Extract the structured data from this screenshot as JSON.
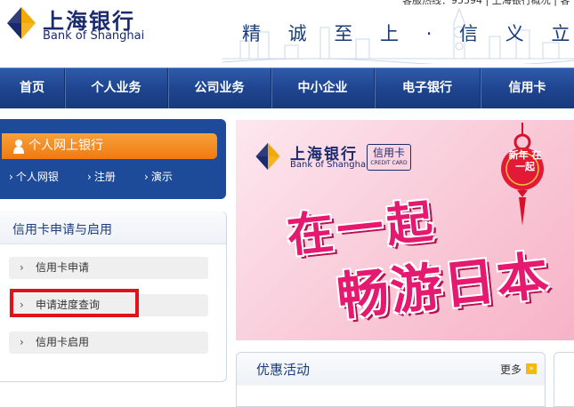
{
  "header": {
    "brand_cn": "上海银行",
    "brand_en": "Bank of Shanghai",
    "hotline": "客服热线：95594 | 上海银行概况 | 客",
    "slogan": "精 诚 至 上 · 信 义 立 行"
  },
  "nav": {
    "items": [
      {
        "label": "首页"
      },
      {
        "label": "个人业务"
      },
      {
        "label": "公司业务"
      },
      {
        "label": "中小企业"
      },
      {
        "label": "电子银行"
      },
      {
        "label": "信用卡"
      }
    ]
  },
  "login": {
    "button_label": "个人网上银行",
    "links": [
      "个人网银",
      "注册",
      "演示"
    ]
  },
  "credit": {
    "title": "信用卡申请与启用",
    "items": [
      {
        "label": "信用卡申请"
      },
      {
        "label": "申请进度查询"
      },
      {
        "label": "信用卡启用"
      }
    ]
  },
  "banner": {
    "brand_cn": "上海银行",
    "brand_en": "Bank of Shanghai",
    "card_tag": "信用卡",
    "card_en": "CREDIT CARD",
    "line1": "在一起",
    "line2": "畅游日本",
    "knot_text": "新年 在一起"
  },
  "promo": {
    "title": "优惠活动",
    "more": "更多"
  },
  "colors": {
    "nav_blue": "#1f4590",
    "login_orange": "#f07a10",
    "highlight_red": "#e0121b",
    "banner_pink": "#e5196f"
  }
}
